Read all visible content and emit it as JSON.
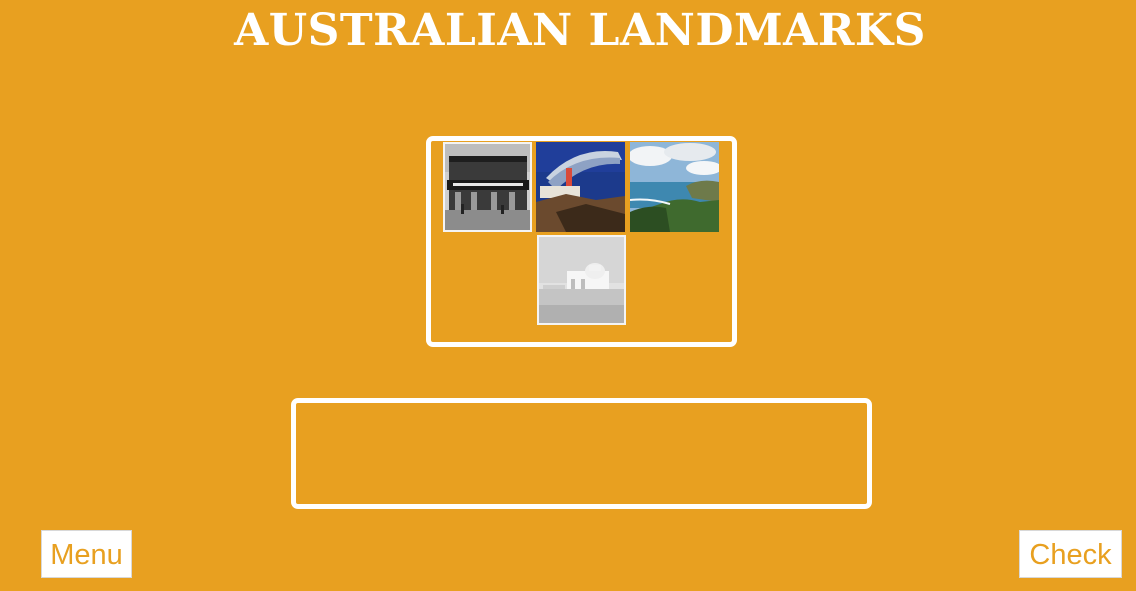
{
  "title": "AUSTRALIAN LANDMARKS",
  "image_pool": {
    "tiles": [
      {
        "icon": "historic-pub-photo",
        "tone": "black-and-white"
      },
      {
        "icon": "modern-building-photo",
        "tone": "color"
      },
      {
        "icon": "coastline-photo",
        "tone": "color"
      },
      {
        "icon": "domed-building-photo",
        "tone": "black-and-white"
      }
    ]
  },
  "answer_box": {},
  "buttons": {
    "menu_label": "Menu",
    "check_label": "Check"
  },
  "colors": {
    "background": "#E8A020",
    "panel_border": "#FFFFFF",
    "button_text": "#E8A020"
  }
}
